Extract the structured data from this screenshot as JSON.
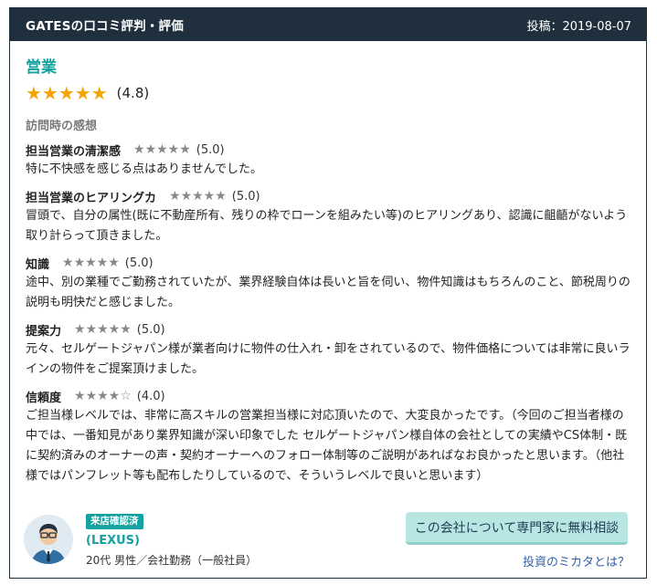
{
  "header": {
    "title": "GATESの口コミ評判・評価",
    "date": "投稿：2019-08-07"
  },
  "review": {
    "category": "営業",
    "overall_stars": "★★★★★",
    "overall_score": "(4.8)",
    "section_heading": "訪問時の感想",
    "items": [
      {
        "name": "担当営業の清潔感",
        "stars": "★★★★★",
        "score": "(5.0)",
        "text": "特に不快感を感じる点はありませんでした。"
      },
      {
        "name": "担当営業のヒアリングカ",
        "stars": "★★★★★",
        "score": "(5.0)",
        "text": "冒頭で、自分の属性(既に不動産所有、残りの枠でローンを組みたい等)のヒアリングあり、認識に齟齬がないよう取り計らって頂きました。"
      },
      {
        "name": "知識",
        "stars": "★★★★★",
        "score": "(5.0)",
        "text": "途中、別の業種でご勤務されていたが、業界経験自体は長いと旨を伺い、物件知識はもちろんのこと、節税周りの説明も明快だと感じました。"
      },
      {
        "name": "提案力",
        "stars": "★★★★★",
        "score": "(5.0)",
        "text": "元々、セルゲートジャパン様が業者向けに物件の仕入れ・卸をされているので、物件価格については非常に良いラインの物件をご提案頂けました。"
      },
      {
        "name": "信頼度",
        "stars": "★★★★☆",
        "score": "(4.0)",
        "text": "ご担当様レベルでは、非常に高スキルの営業担当様に対応頂いたので、大変良かったです。（今回のご担当者様の中では、一番知見があり業界知識が深い印象でした セルゲートジャパン様自体の会社としての実績やCS体制・既に契約済みのオーナーの声・契約オーナーへのフォロー体制等のご説明があればなお良かったと思います。（他社様ではパンフレット等も配布したりしているので、そういうレベルで良いと思います）"
      }
    ]
  },
  "reviewer": {
    "badge": "来店確認済",
    "name": "(LEXUS)",
    "info": "20代 男性／会社勤務（一般社員）"
  },
  "actions": {
    "consult_label": "この会社について専門家に無料相談",
    "about_link": "投資のミカタとは？"
  },
  "colors": {
    "header_bg": "#1f2f3d",
    "accent": "#13a2a0",
    "star_gold": "#f4a300",
    "star_gray": "#888888",
    "button_bg": "#b8e6e2",
    "link": "#2f5fa8"
  }
}
